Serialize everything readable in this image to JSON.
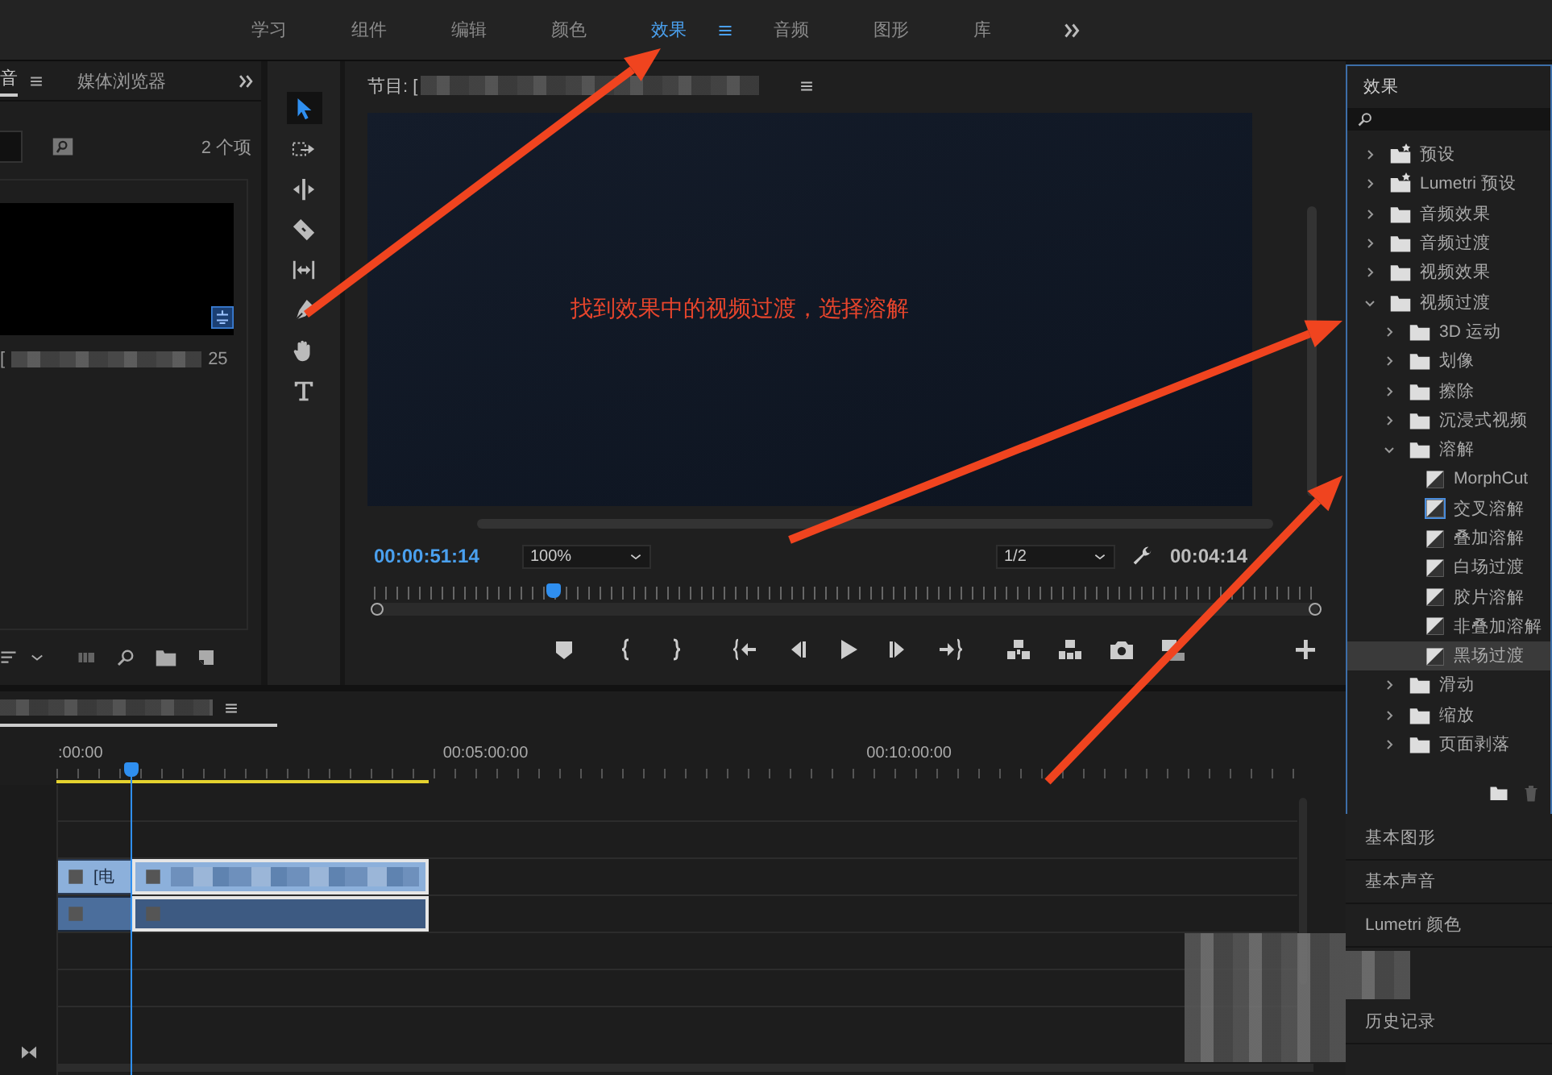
{
  "workspace_tabs": [
    {
      "label": "学习",
      "selected": false
    },
    {
      "label": "组件",
      "selected": false
    },
    {
      "label": "编辑",
      "selected": false
    },
    {
      "label": "颜色",
      "selected": false
    },
    {
      "label": "效果",
      "selected": true
    },
    {
      "label": "音频",
      "selected": false
    },
    {
      "label": "图形",
      "selected": false
    },
    {
      "label": "库",
      "selected": false
    }
  ],
  "project_panel": {
    "tabs": [
      {
        "label": "音",
        "selected": true
      },
      {
        "label": "媒体浏览器",
        "selected": false
      }
    ],
    "item_count": "2 个项",
    "items": [
      {
        "label_start": "[",
        "label_end": "25"
      }
    ]
  },
  "tools": [
    {
      "kind": "selection",
      "selected": true
    },
    {
      "kind": "track-select",
      "selected": false
    },
    {
      "kind": "ripple",
      "selected": false
    },
    {
      "kind": "razor",
      "selected": false
    },
    {
      "kind": "slip",
      "selected": false
    },
    {
      "kind": "pen",
      "selected": false
    },
    {
      "kind": "hand",
      "selected": false
    },
    {
      "kind": "type",
      "selected": false
    }
  ],
  "program_monitor": {
    "title": "节目: [",
    "annotation": "找到效果中的视频过渡，选择溶解",
    "timecode": "00:00:51:14",
    "zoom": "100%",
    "resolution": "1/2",
    "duration": "00:04:14",
    "playhead": {
      "level": 0.19
    }
  },
  "timeline": {
    "ruler": [
      ":00:00",
      "00:05:00:00",
      "00:10:00:00"
    ],
    "work_area": {
      "level": 0.3
    },
    "playhead": {
      "level": 0.06
    },
    "video_clip_label": "[电"
  },
  "effects": {
    "title": "效果",
    "tree": [
      {
        "label": "预设",
        "kind": "preset-folder",
        "expanded": false
      },
      {
        "label": "Lumetri 预设",
        "kind": "preset-folder",
        "expanded": false
      },
      {
        "label": "音频效果",
        "kind": "folder",
        "expanded": false
      },
      {
        "label": "音频过渡",
        "kind": "folder",
        "expanded": false
      },
      {
        "label": "视频效果",
        "kind": "folder",
        "expanded": false
      },
      {
        "label": "视频过渡",
        "kind": "folder",
        "expanded": true,
        "children": [
          {
            "label": "3D 运动",
            "kind": "folder",
            "expanded": false
          },
          {
            "label": "划像",
            "kind": "folder",
            "expanded": false
          },
          {
            "label": "擦除",
            "kind": "folder",
            "expanded": false
          },
          {
            "label": "沉浸式视频",
            "kind": "folder",
            "expanded": false
          },
          {
            "label": "溶解",
            "kind": "folder",
            "expanded": true,
            "children": [
              {
                "label": "MorphCut",
                "kind": "transition",
                "selected": false,
                "default": false
              },
              {
                "label": "交叉溶解",
                "kind": "transition",
                "selected": false,
                "default": true
              },
              {
                "label": "叠加溶解",
                "kind": "transition",
                "selected": false,
                "default": false
              },
              {
                "label": "白场过渡",
                "kind": "transition",
                "selected": false,
                "default": false
              },
              {
                "label": "胶片溶解",
                "kind": "transition",
                "selected": false,
                "default": false
              },
              {
                "label": "非叠加溶解",
                "kind": "transition",
                "selected": false,
                "default": false
              },
              {
                "label": "黑场过渡",
                "kind": "transition",
                "selected": true,
                "default": false
              }
            ]
          },
          {
            "label": "滑动",
            "kind": "folder",
            "expanded": false
          },
          {
            "label": "缩放",
            "kind": "folder",
            "expanded": false
          },
          {
            "label": "页面剥落",
            "kind": "folder",
            "expanded": false
          }
        ]
      }
    ]
  },
  "panels": [
    {
      "kind": "panel",
      "label": "基本图形"
    },
    {
      "kind": "panel",
      "label": "基本声音"
    },
    {
      "kind": "panel",
      "label": "Lumetri 颜色"
    },
    {
      "kind": "obscured"
    },
    {
      "kind": "panel",
      "label": "历史记录"
    }
  ]
}
